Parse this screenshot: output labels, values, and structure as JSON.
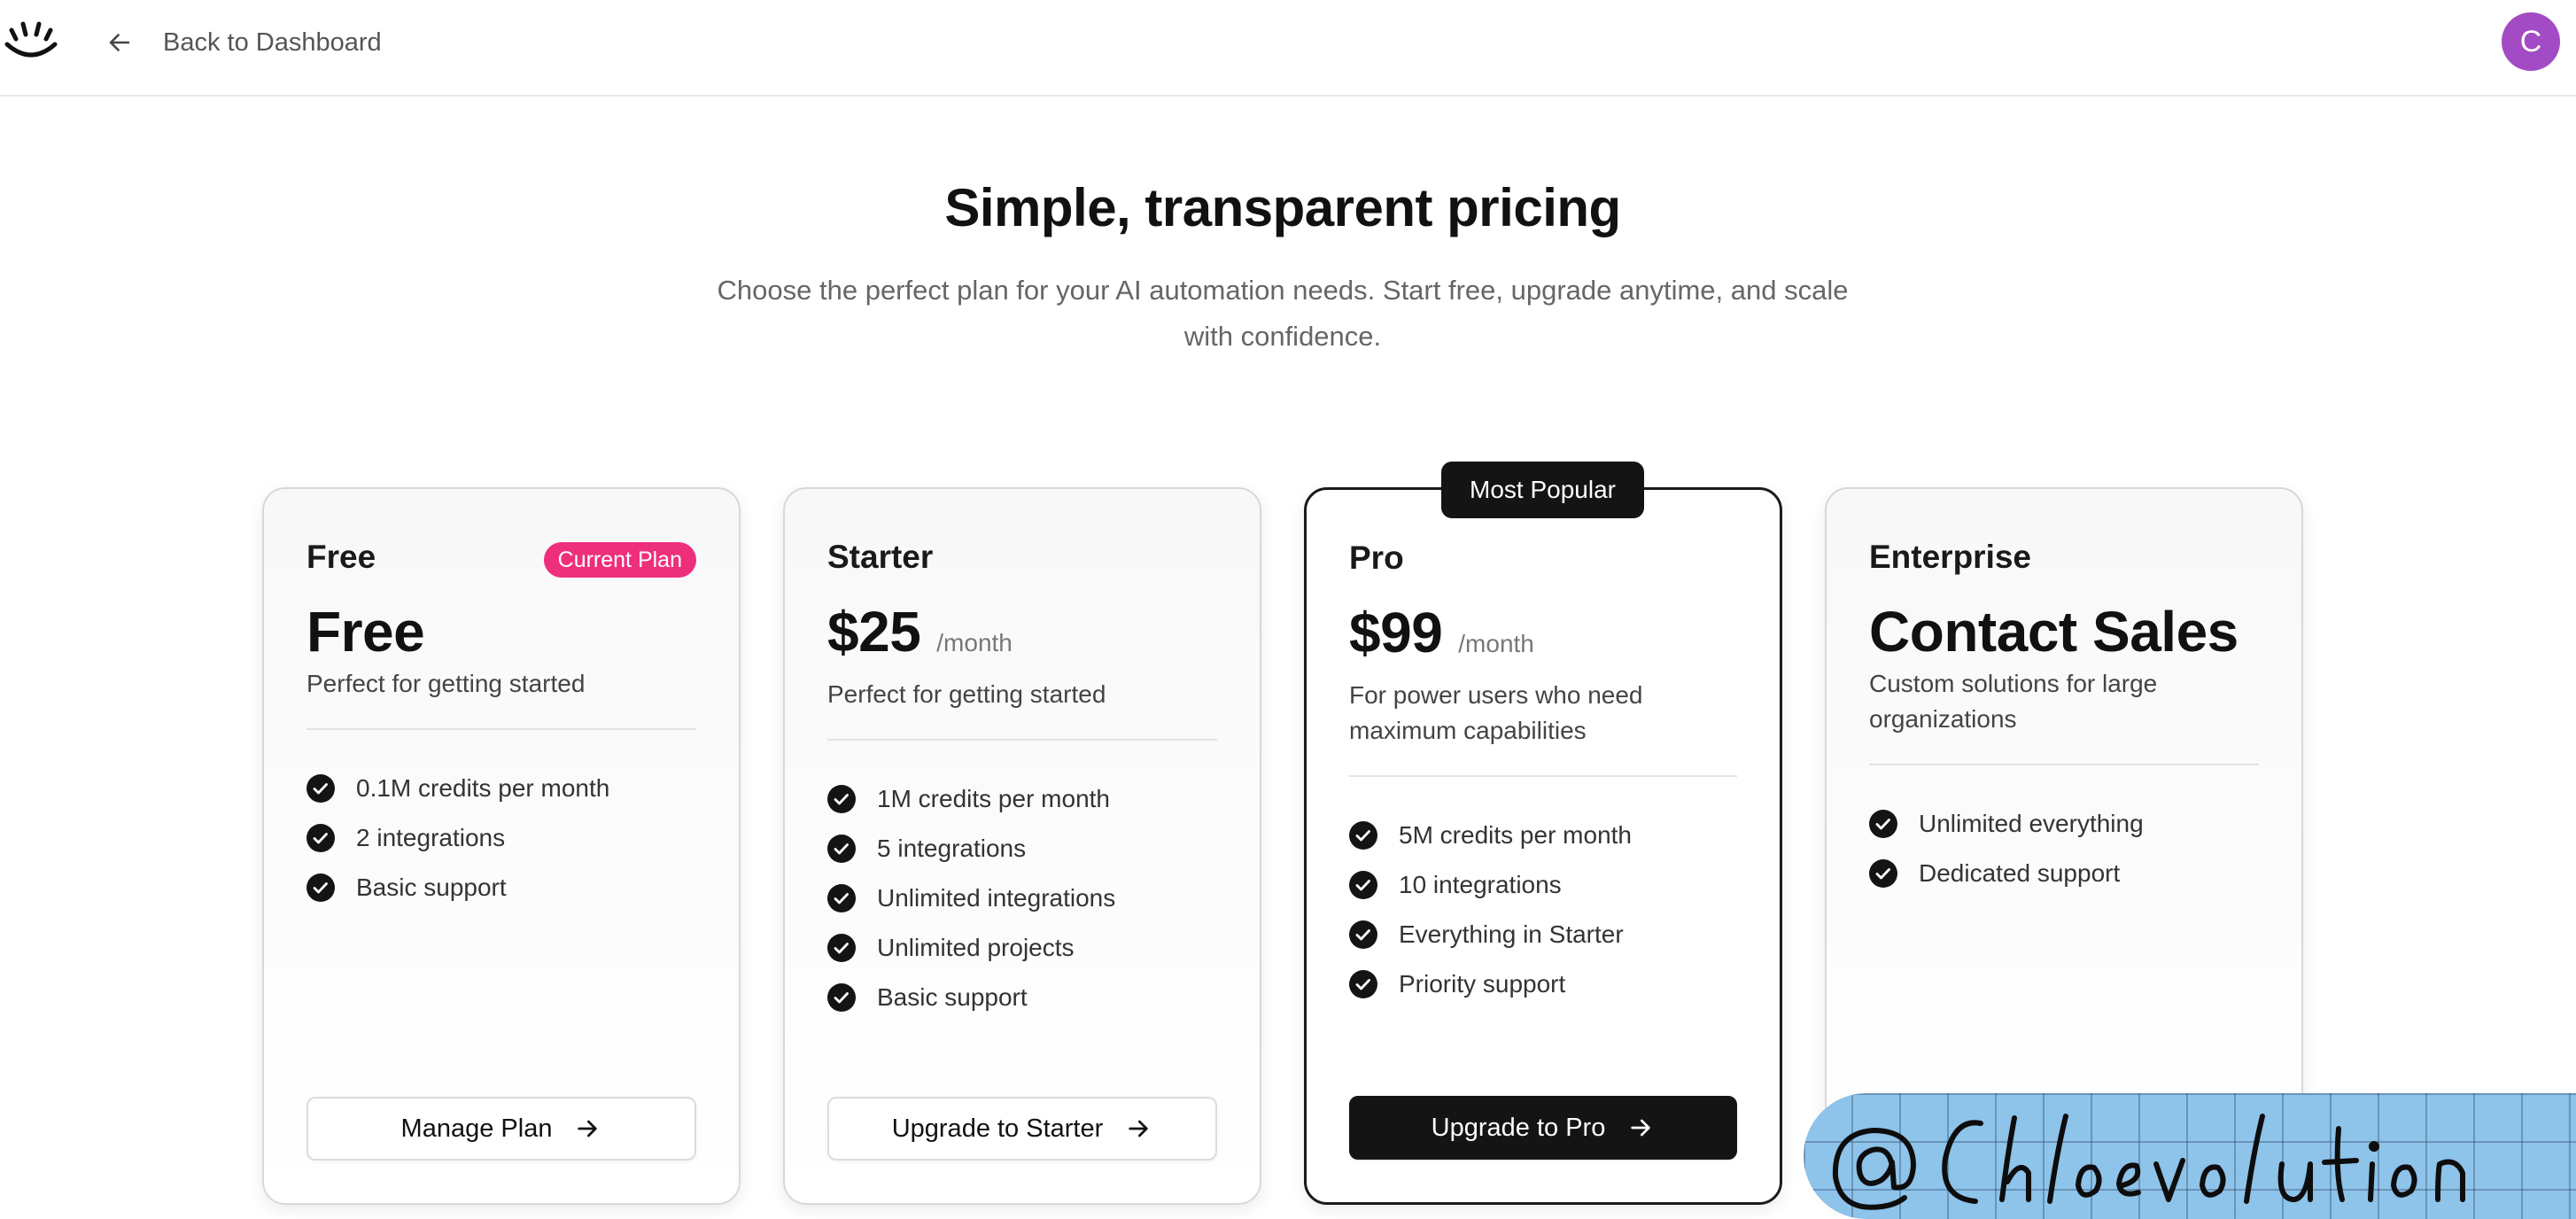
{
  "header": {
    "back_label": "Back to Dashboard",
    "avatar_initial": "C",
    "avatar_color": "#a24bc4"
  },
  "hero": {
    "title": "Simple, transparent pricing",
    "subtitle": "Choose the perfect plan for your AI automation needs. Start free, upgrade anytime, and scale with confidence."
  },
  "plans": [
    {
      "name": "Free",
      "badge": "Current Plan",
      "price": "Free",
      "period": "",
      "description": "Perfect for getting started",
      "features": [
        "0.1M credits per month",
        "2 integrations",
        "Basic support"
      ],
      "button_label": "Manage Plan"
    },
    {
      "name": "Starter",
      "price": "$25",
      "period": "/month",
      "description": "Perfect for getting started",
      "features": [
        "1M credits per month",
        "5 integrations",
        "Unlimited integrations",
        "Unlimited projects",
        "Basic support"
      ],
      "button_label": "Upgrade to Starter"
    },
    {
      "name": "Pro",
      "ribbon": "Most Popular",
      "price": "$99",
      "period": "/month",
      "description": "For power users who need maximum capabilities",
      "features": [
        "5M credits per month",
        "10 integrations",
        "Everything in Starter",
        "Priority support"
      ],
      "button_label": "Upgrade to Pro"
    },
    {
      "name": "Enterprise",
      "price": "Contact Sales",
      "period": "",
      "description": "Custom solutions for large organizations",
      "features": [
        "Unlimited everything",
        "Dedicated support"
      ]
    }
  ],
  "watermark": {
    "text": "@ Chloevolution"
  },
  "colors": {
    "accent_badge": "#ee2f7c",
    "dark_button": "#141414",
    "watermark_bg": "#8ec3ea"
  },
  "icons": {
    "logo": "sun-logo-icon",
    "back": "arrow-left-icon",
    "check": "check-circle-icon",
    "button": "arrow-right-icon"
  }
}
